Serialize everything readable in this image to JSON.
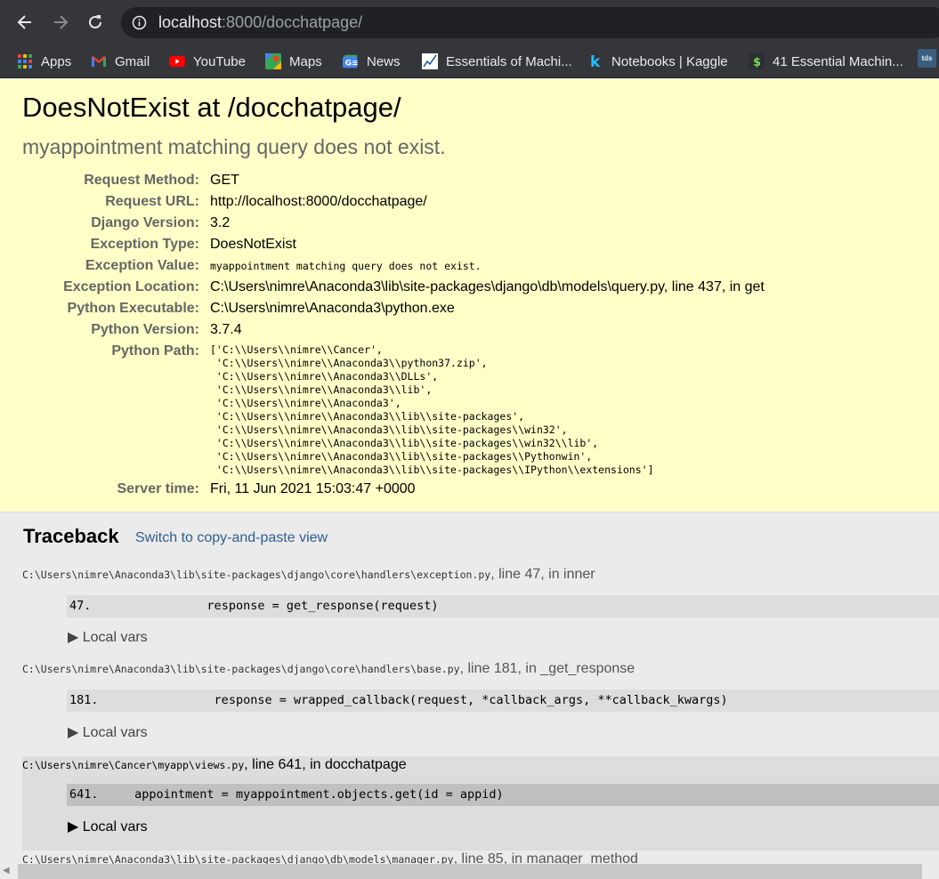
{
  "browser": {
    "url_host": "localhost",
    "url_rest": ":8000/docchatpage/",
    "bookmarks": [
      "Apps",
      "Gmail",
      "YouTube",
      "Maps",
      "News",
      "Essentials of Machi...",
      "Notebooks | Kaggle",
      "41 Essential Machin..."
    ],
    "ext_label": "tds"
  },
  "summary": {
    "title": "DoesNotExist at /docchatpage/",
    "subtitle": "myappointment matching query does not exist.",
    "fields": [
      {
        "label": "Request Method:",
        "value": "GET"
      },
      {
        "label": "Request URL:",
        "value": "http://localhost:8000/docchatpage/"
      },
      {
        "label": "Django Version:",
        "value": "3.2"
      },
      {
        "label": "Exception Type:",
        "value": "DoesNotExist"
      },
      {
        "label": "Exception Value:",
        "value": "myappointment matching query does not exist."
      },
      {
        "label": "Exception Location:",
        "value": "C:\\Users\\nimre\\Anaconda3\\lib\\site-packages\\django\\db\\models\\query.py, line 437, in get"
      },
      {
        "label": "Python Executable:",
        "value": "C:\\Users\\nimre\\Anaconda3\\python.exe"
      },
      {
        "label": "Python Version:",
        "value": "3.7.4"
      },
      {
        "label": "Python Path:",
        "value": "['C:\\\\Users\\\\nimre\\\\Cancer',\n 'C:\\\\Users\\\\nimre\\\\Anaconda3\\\\python37.zip',\n 'C:\\\\Users\\\\nimre\\\\Anaconda3\\\\DLLs',\n 'C:\\\\Users\\\\nimre\\\\Anaconda3\\\\lib',\n 'C:\\\\Users\\\\nimre\\\\Anaconda3',\n 'C:\\\\Users\\\\nimre\\\\Anaconda3\\\\lib\\\\site-packages',\n 'C:\\\\Users\\\\nimre\\\\Anaconda3\\\\lib\\\\site-packages\\\\win32',\n 'C:\\\\Users\\\\nimre\\\\Anaconda3\\\\lib\\\\site-packages\\\\win32\\\\lib',\n 'C:\\\\Users\\\\nimre\\\\Anaconda3\\\\lib\\\\site-packages\\\\Pythonwin',\n 'C:\\\\Users\\\\nimre\\\\Anaconda3\\\\lib\\\\site-packages\\\\IPython\\\\extensions']"
      },
      {
        "label": "Server time:",
        "value": "Fri, 11 Jun 2021 15:03:47 +0000"
      }
    ]
  },
  "traceback": {
    "title": "Traceback",
    "switch_link": "Switch to copy-and-paste view",
    "frames": [
      {
        "path": "C:\\Users\\nimre\\Anaconda3\\lib\\site-packages\\django\\core\\handlers\\exception.py",
        "where": ", line 47, in inner",
        "line_no": "47.",
        "code": "                response = get_response(request)",
        "local_vars": "▶ Local vars"
      },
      {
        "path": "C:\\Users\\nimre\\Anaconda3\\lib\\site-packages\\django\\core\\handlers\\base.py",
        "where": ", line 181, in _get_response",
        "line_no": "181.",
        "code": "                response = wrapped_callback(request, *callback_args, **callback_kwargs)",
        "local_vars": "▶ Local vars"
      },
      {
        "path": "C:\\Users\\nimre\\Cancer\\myapp\\views.py",
        "where": ", line 641, in docchatpage",
        "line_no": "641.",
        "code": "     appointment = myappointment.objects.get(id = appid)",
        "local_vars": "▶ Local vars"
      },
      {
        "path": "C:\\Users\\nimre\\Anaconda3\\lib\\site-packages\\django\\db\\models\\manager.py",
        "where": ", line 85, in manager_method"
      }
    ]
  }
}
